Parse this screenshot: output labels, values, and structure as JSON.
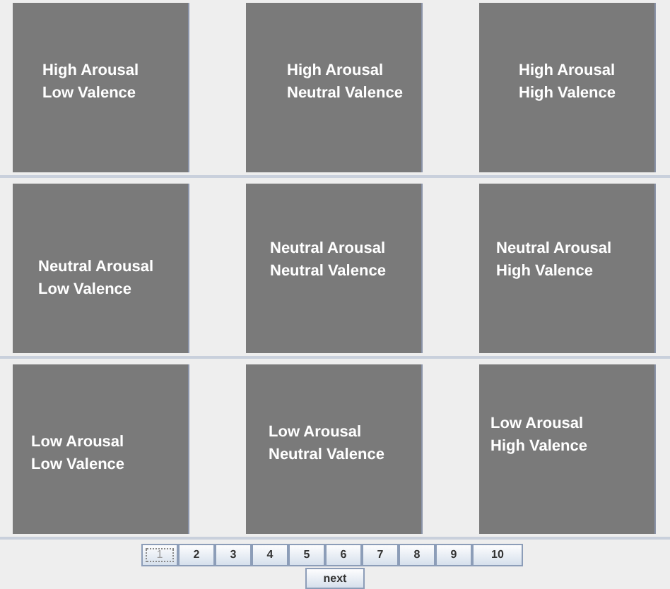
{
  "grid_rows": [
    {
      "tiles": [
        {
          "lines": [
            "High Arousal",
            "Low Valence"
          ]
        },
        {
          "lines": [
            "High Arousal",
            "Neutral Valence"
          ]
        },
        {
          "lines": [
            "High Arousal",
            "High Valence"
          ]
        }
      ]
    },
    {
      "tiles": [
        {
          "lines": [
            "Neutral Arousal",
            "Low Valence"
          ]
        },
        {
          "lines": [
            "Neutral Arousal",
            "Neutral Valence"
          ]
        },
        {
          "lines": [
            "Neutral Arousal",
            "High Valence"
          ]
        }
      ]
    },
    {
      "tiles": [
        {
          "lines": [
            "Low Arousal",
            "Low Valence"
          ]
        },
        {
          "lines": [
            "Low Arousal",
            "Neutral Valence"
          ]
        },
        {
          "lines": [
            "Low Arousal",
            "High Valence"
          ]
        }
      ]
    }
  ],
  "pages": [
    {
      "label": "1",
      "selected": true
    },
    {
      "label": "2",
      "selected": false
    },
    {
      "label": "3",
      "selected": false
    },
    {
      "label": "4",
      "selected": false
    },
    {
      "label": "5",
      "selected": false
    },
    {
      "label": "6",
      "selected": false
    },
    {
      "label": "7",
      "selected": false
    },
    {
      "label": "8",
      "selected": false
    },
    {
      "label": "9",
      "selected": false
    },
    {
      "label": "10",
      "selected": false
    }
  ],
  "next_button": "next"
}
